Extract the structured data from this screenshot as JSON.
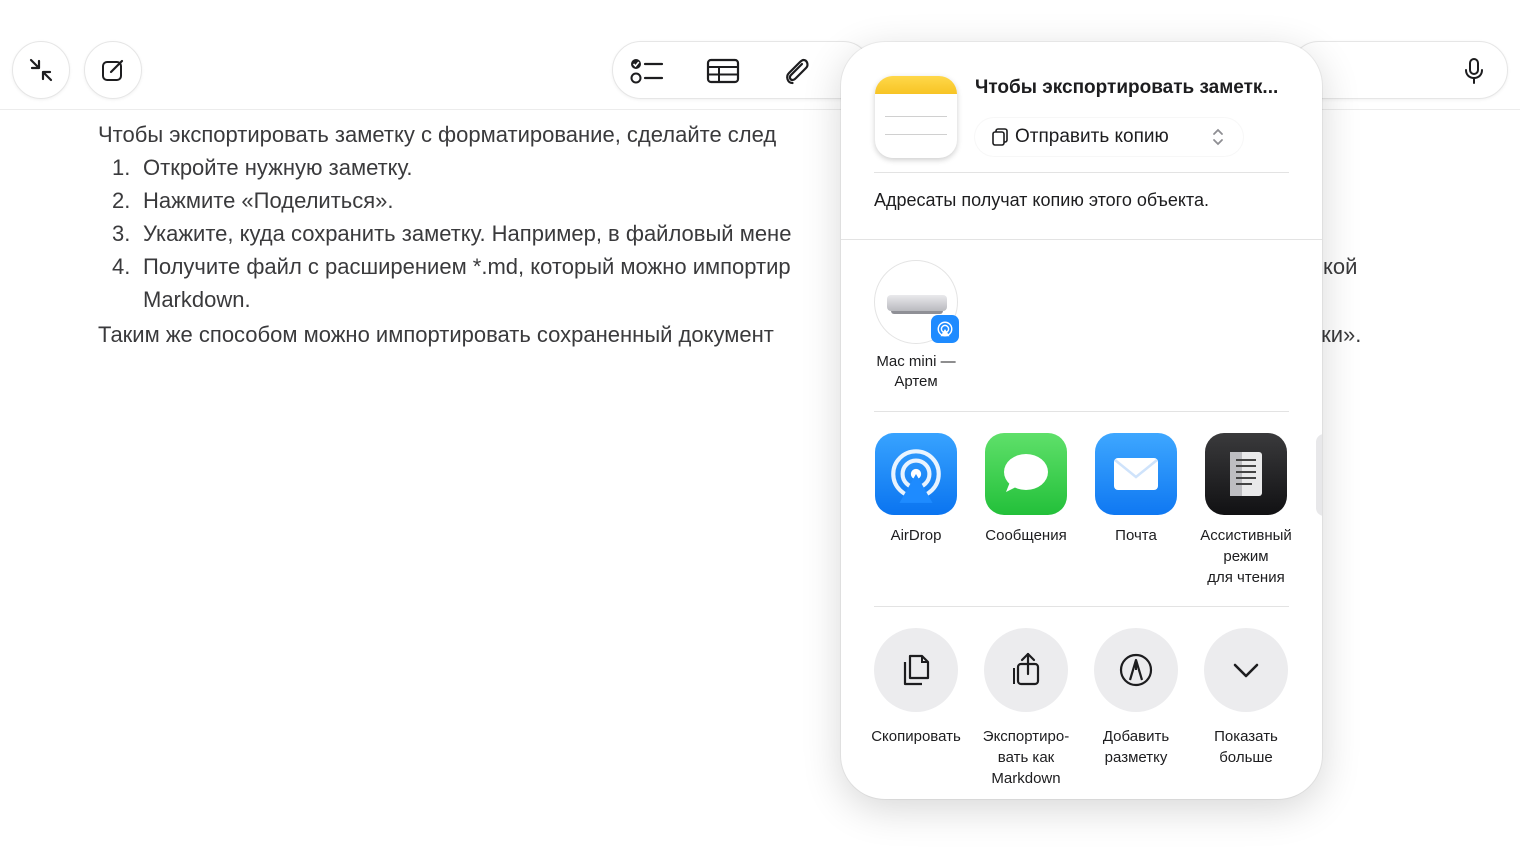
{
  "toolbar": {
    "left_buttons": [
      "collapse-icon",
      "compose-icon"
    ],
    "tools": [
      "checklist-icon",
      "table-icon",
      "paperclip-icon"
    ],
    "right": [
      "microphone-icon"
    ]
  },
  "note": {
    "intro": "Чтобы экспортировать заметку с форматирование, сделайте след",
    "steps": [
      {
        "num": "1.",
        "text": "Откройте нужную заметку."
      },
      {
        "num": "2.",
        "text": "Нажмите «Поделиться»."
      },
      {
        "num": "3.",
        "text": "Укажите, куда сохранить заметку. Например, в файловый мене"
      },
      {
        "num": "4.",
        "text": "Получите файл с расширением *.md, который можно импортир",
        "tail": "кой",
        "cont": "Markdown."
      }
    ],
    "outro": "Таким же способом можно импортировать сохраненный документ",
    "outro_tail": "тки»."
  },
  "share_sheet": {
    "title": "Чтобы экспортировать заметк...",
    "send_option": "Отправить копию",
    "recipients_note": "Адресаты получат копию этого объекта.",
    "device": {
      "name_line1": "Mac mini —",
      "name_line2": "Артем"
    },
    "apps": [
      {
        "label": "AirDrop",
        "icon": "airdrop-icon",
        "color": "#1e8bff"
      },
      {
        "label": "Сообщения",
        "icon": "messages-icon",
        "color": "#34c759"
      },
      {
        "label": "Почта",
        "icon": "mail-icon",
        "color": "#1a8cff"
      },
      {
        "label_lines": [
          "Ассистивный",
          "режим",
          "для чтения"
        ],
        "icon": "assistive-reader-icon",
        "color": "#1c1c1e"
      }
    ],
    "actions": [
      {
        "label_lines": [
          "Скопировать"
        ],
        "icon": "copy-icon"
      },
      {
        "label_lines": [
          "Экспортиро-",
          "вать как",
          "Markdown"
        ],
        "icon": "export-icon"
      },
      {
        "label_lines": [
          "Добавить",
          "разметку"
        ],
        "icon": "markup-icon"
      },
      {
        "label_lines": [
          "Показать",
          "больше"
        ],
        "icon": "chevron-down-icon"
      }
    ]
  }
}
